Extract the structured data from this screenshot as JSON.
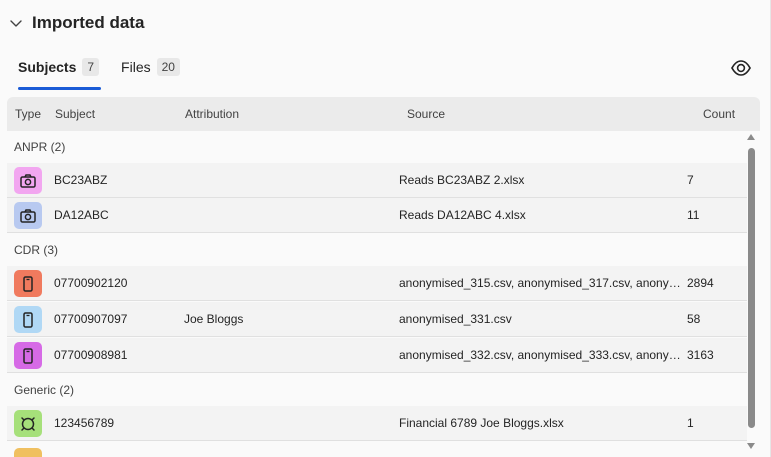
{
  "section": {
    "title": "Imported data",
    "toggle_icon": "chevron-down-icon"
  },
  "tabs": [
    {
      "label": "Subjects",
      "count": "7",
      "active": true
    },
    {
      "label": "Files",
      "count": "20",
      "active": false
    }
  ],
  "toolbar": {
    "visibility_icon": "eye-icon"
  },
  "table": {
    "columns": {
      "type": "Type",
      "subject": "Subject",
      "attribution": "Attribution",
      "source": "Source",
      "count": "Count"
    },
    "groups": [
      {
        "label": "ANPR (2)",
        "rows": [
          {
            "icon": "camera-icon",
            "color": "#f2a6f0",
            "subject": "BC23ABZ",
            "attribution": "",
            "source": "Reads BC23ABZ 2.xlsx",
            "count": "7"
          },
          {
            "icon": "camera-icon",
            "color": "#b8c9f0",
            "subject": "DA12ABC",
            "attribution": "",
            "source": "Reads DA12ABC 4.xlsx",
            "count": "11"
          }
        ]
      },
      {
        "label": "CDR (3)",
        "rows": [
          {
            "icon": "phone-icon",
            "color": "#f07a5e",
            "subject": "07700902120",
            "attribution": "",
            "source": "anonymised_315.csv, anonymised_317.csv, anonymis...",
            "count": "2894"
          },
          {
            "icon": "phone-icon",
            "color": "#b0d8f5",
            "subject": "07700907097",
            "attribution": "Joe Bloggs",
            "source": "anonymised_331.csv",
            "count": "58"
          },
          {
            "icon": "phone-icon",
            "color": "#d66ae6",
            "subject": "07700908981",
            "attribution": "",
            "source": "anonymised_332.csv, anonymised_333.csv, anonymis...",
            "count": "3163"
          }
        ]
      },
      {
        "label": "Generic (2)",
        "rows": [
          {
            "icon": "generic-icon",
            "color": "#a6e07a",
            "subject": "123456789",
            "attribution": "",
            "source": "Financial 6789 Joe Bloggs.xlsx",
            "count": "1"
          }
        ]
      }
    ]
  }
}
